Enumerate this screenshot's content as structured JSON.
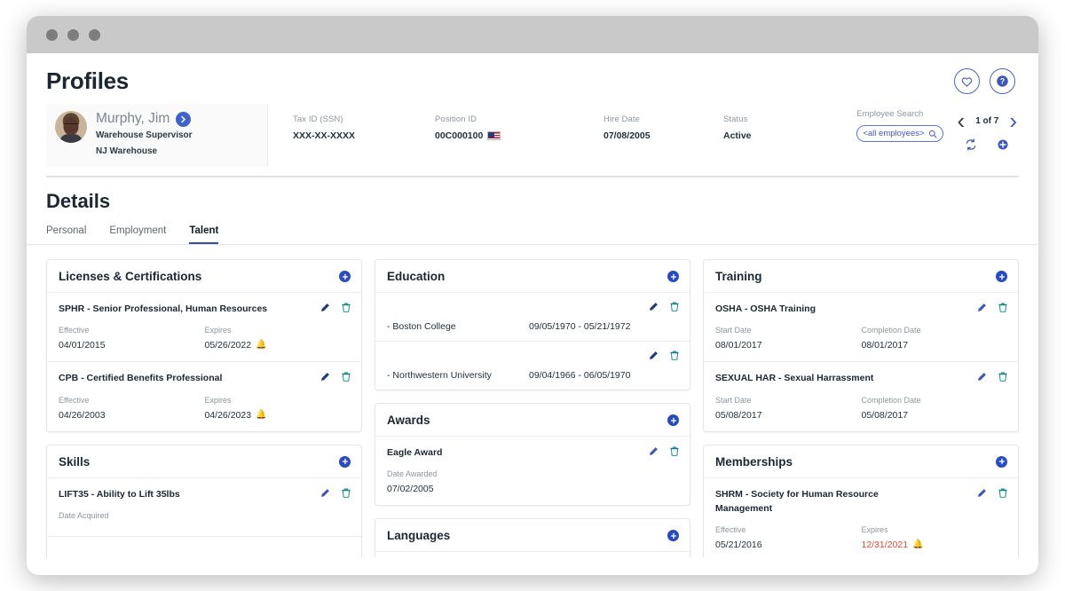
{
  "window": {
    "dots": 3
  },
  "header": {
    "title": "Profiles",
    "favorite_icon": "heart-icon",
    "help_icon": "help-icon"
  },
  "employee": {
    "name": "Murphy, Jim",
    "job_title": "Warehouse Supervisor",
    "location": "NJ Warehouse",
    "fields": [
      {
        "label": "Tax ID (SSN)",
        "value": "XXX-XX-XXXX",
        "flag": false
      },
      {
        "label": "Position ID",
        "value": "00C000100",
        "flag": true
      },
      {
        "label": "Hire Date",
        "value": "07/08/2005",
        "flag": false
      },
      {
        "label": "Status",
        "value": "Active",
        "flag": false
      }
    ]
  },
  "search": {
    "label": "Employee Search",
    "value": "<all employees>",
    "icon": "search-icon"
  },
  "pager": {
    "count": "1 of 7",
    "prev_icon": "chevron-left-icon",
    "next_icon": "chevron-right-icon",
    "refresh_icon": "refresh-icon",
    "add_icon": "add-circle-icon"
  },
  "details": {
    "title": "Details",
    "tabs": [
      {
        "label": "Personal",
        "active": false
      },
      {
        "label": "Employment",
        "active": false
      },
      {
        "label": "Talent",
        "active": true
      }
    ]
  },
  "colors": {
    "accent_blue": "#2a4bb8",
    "link_blue": "#3f57b5",
    "teal": "#16808a",
    "expired_red": "#e8472e",
    "titlebar_gray": "#c9c9c9"
  },
  "cards": {
    "licenses": {
      "title": "Licenses & Certifications",
      "rows": [
        {
          "title": "SPHR - Senior Professional, Human Resources",
          "left_label": "Effective",
          "left_value": "04/01/2015",
          "right_label": "Expires",
          "right_value": "05/26/2022",
          "bell": true,
          "expired": false
        },
        {
          "title": "CPB - Certified Benefits Professional",
          "left_label": "Effective",
          "left_value": "04/26/2003",
          "right_label": "Expires",
          "right_value": "04/26/2023",
          "bell": true,
          "expired": false
        }
      ]
    },
    "skills": {
      "title": "Skills",
      "rows": [
        {
          "title": "LIFT35 - Ability to Lift 35lbs",
          "left_label": "Date Acquired",
          "left_value": "",
          "right_label": "",
          "right_value": "",
          "bell": false,
          "expired": false
        }
      ]
    },
    "education": {
      "title": "Education",
      "rows": [
        {
          "degree": "",
          "school": "- Boston College",
          "dates": "09/05/1970 - 05/21/1972"
        },
        {
          "degree": "",
          "school": "- Northwestern University",
          "dates": "09/04/1966 - 06/05/1970"
        }
      ]
    },
    "awards": {
      "title": "Awards",
      "rows": [
        {
          "title": "Eagle Award",
          "left_label": "Date Awarded",
          "left_value": "07/02/2005",
          "right_label": "",
          "right_value": "",
          "bell": false,
          "expired": false
        }
      ]
    },
    "languages": {
      "title": "Languages",
      "rows": []
    },
    "training": {
      "title": "Training",
      "rows": [
        {
          "title": "OSHA - OSHA Training",
          "left_label": "Start Date",
          "left_value": "08/01/2017",
          "right_label": "Completion Date",
          "right_value": "08/01/2017",
          "bell": false,
          "expired": false
        },
        {
          "title": "SEXUAL HAR - Sexual Harrassment",
          "left_label": "Start Date",
          "left_value": "05/08/2017",
          "right_label": "Completion Date",
          "right_value": "05/08/2017",
          "bell": false,
          "expired": false
        }
      ]
    },
    "memberships": {
      "title": "Memberships",
      "rows": [
        {
          "title": "SHRM - Society for Human Resource Management",
          "left_label": "Effective",
          "left_value": "05/21/2016",
          "right_label": "Expires",
          "right_value": "12/31/2021",
          "bell": true,
          "expired": true
        }
      ]
    }
  },
  "icons": {
    "edit": "pencil-icon",
    "delete": "trash-icon",
    "add": "add-circle-icon",
    "bell": "bell-icon"
  }
}
